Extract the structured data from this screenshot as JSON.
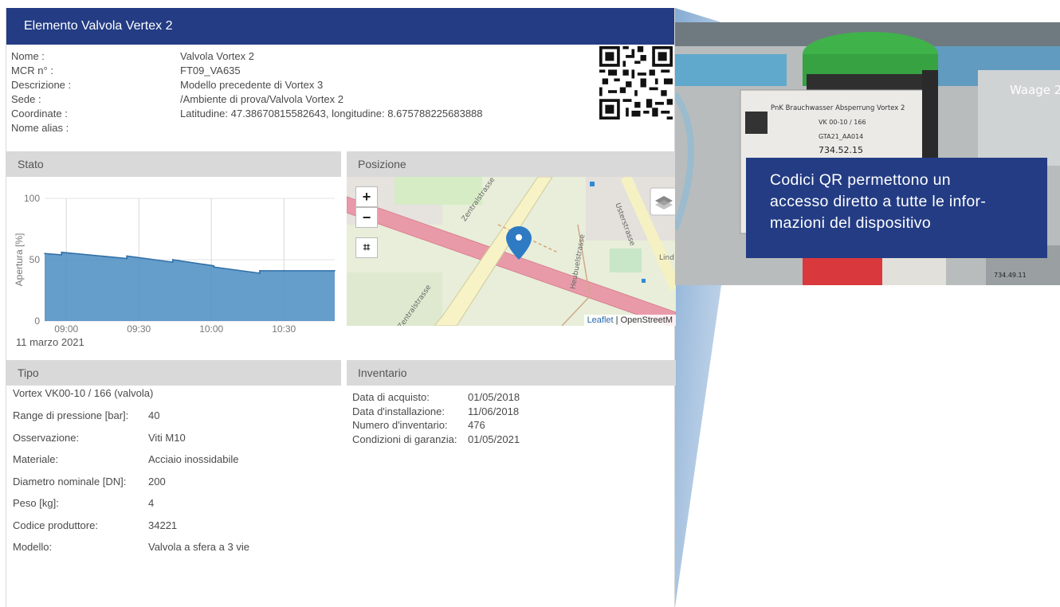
{
  "header": {
    "title": "Elemento Valvola Vertex 2"
  },
  "info": [
    {
      "label": "Nome :",
      "value": "Valvola Vortex 2"
    },
    {
      "label": "MCR n° :",
      "value": "FT09_VA635"
    },
    {
      "label": "Descrizione :",
      "value": "Modello precedente di Vortex 3"
    },
    {
      "label": "Sede :",
      "value": "/Ambiente di prova/Valvola Vortex 2"
    },
    {
      "label": "Coordinate :",
      "value": "Latitudine: 47.38670815582643, longitudine: 8.675788225683888"
    },
    {
      "label": "Nome alias :",
      "value": ""
    }
  ],
  "sections": {
    "stato": "Stato",
    "posizione": "Posizione",
    "tipo": "Tipo",
    "inventario": "Inventario"
  },
  "chart_data": {
    "type": "area",
    "ylabel": "Apertura [%]",
    "xlabel": "",
    "ylim": [
      0,
      100
    ],
    "yticks": [
      "0",
      "50",
      "100"
    ],
    "xticks": [
      "09:00",
      "09:30",
      "10:00",
      "10:30"
    ],
    "date_label": "11 marzo 2021",
    "x": [
      "08:53",
      "09:00",
      "09:00",
      "09:27",
      "09:27",
      "09:46",
      "09:46",
      "10:03",
      "10:03",
      "10:22",
      "10:22",
      "10:53"
    ],
    "values": [
      55,
      54,
      56,
      51,
      53,
      48,
      50,
      45,
      44,
      39,
      41,
      41
    ],
    "color": "#4a8cc2",
    "grid": true
  },
  "map": {
    "zoom_in": "+",
    "zoom_out": "−",
    "crop_icon": "⌗",
    "streets": [
      "Zentralstrasse",
      "Zentralstrasse",
      "Heubuelstrasse",
      "Usterstrasse",
      "Lind"
    ],
    "attribution_leaflet": "Leaflet",
    "attribution_osm": "| OpenStreetM"
  },
  "tipo": {
    "title": "Vortex VK00-10 / 166 (valvola)",
    "rows": [
      {
        "label": "Range di pressione [bar]:",
        "value": "40"
      },
      {
        "label": "Osservazione:",
        "value": "Viti M10"
      },
      {
        "label": "Materiale:",
        "value": "Acciaio inossidabile"
      },
      {
        "label": "Diametro nominale [DN]:",
        "value": "200"
      },
      {
        "label": "Peso [kg]:",
        "value": "4"
      },
      {
        "label": "Codice produttore:",
        "value": "34221"
      },
      {
        "label": "Modello:",
        "value": "Valvola a sfera a 3 vie"
      }
    ]
  },
  "inventario": [
    {
      "label": "Data di acquisto:",
      "value": "01/05/2018"
    },
    {
      "label": "Data d'installazione:",
      "value": "11/06/2018"
    },
    {
      "label": "Numero d'inventario:",
      "value": "476"
    },
    {
      "label": "Condizioni di garanzia:",
      "value": "01/05/2021"
    }
  ],
  "photo": {
    "plate_line1": "PnK Brauchwasser Absperrung Vortex 2",
    "plate_line2": "VK 00-10 / 166",
    "plate_line3": "GTA21_AA014",
    "plate_line4": "734.52.15",
    "brand_text": "Waage 2",
    "small_label": "734.49.11"
  },
  "callout": {
    "line1": "Codici QR permettono un",
    "line2": "accesso diretto a tutte le infor-",
    "line3": "mazioni del dispositivo"
  }
}
